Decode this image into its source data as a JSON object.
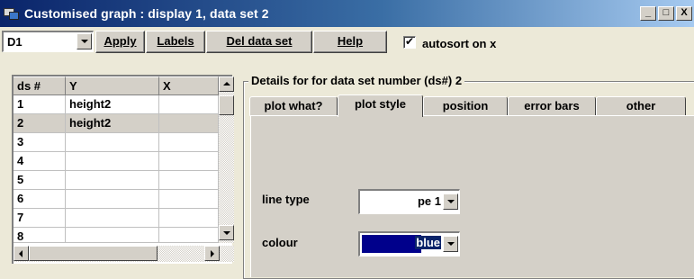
{
  "window": {
    "title": "Customised graph : display 1, data set 2",
    "controls": [
      "_",
      "□",
      "X"
    ]
  },
  "toolbar": {
    "display_select": "D1",
    "apply": "Apply",
    "labels": "Labels",
    "del_data_set": "Del data set",
    "help": "Help",
    "autosort_label": "autosort on x",
    "autosort_checked": true
  },
  "table": {
    "headers": [
      "ds #",
      "Y",
      "X"
    ],
    "rows": [
      {
        "ds": "1",
        "y": "height2",
        "x": ""
      },
      {
        "ds": "2",
        "y": "height2",
        "x": ""
      },
      {
        "ds": "3",
        "y": "",
        "x": ""
      },
      {
        "ds": "4",
        "y": "",
        "x": ""
      },
      {
        "ds": "5",
        "y": "",
        "x": ""
      },
      {
        "ds": "6",
        "y": "",
        "x": ""
      },
      {
        "ds": "7",
        "y": "",
        "x": ""
      },
      {
        "ds": "8",
        "y": "",
        "x": ""
      }
    ],
    "selected_row": "2"
  },
  "details": {
    "group_title": "Details for for data set number (ds#) 2",
    "tabs": [
      "plot what?",
      "plot style",
      "position",
      "error bars",
      "other"
    ],
    "active_tab": "plot style",
    "line_type_label": "line type",
    "line_type_value": "pe 1",
    "colour_label": "colour",
    "colour_value": "blue",
    "colour_swatch": "#00008b"
  }
}
